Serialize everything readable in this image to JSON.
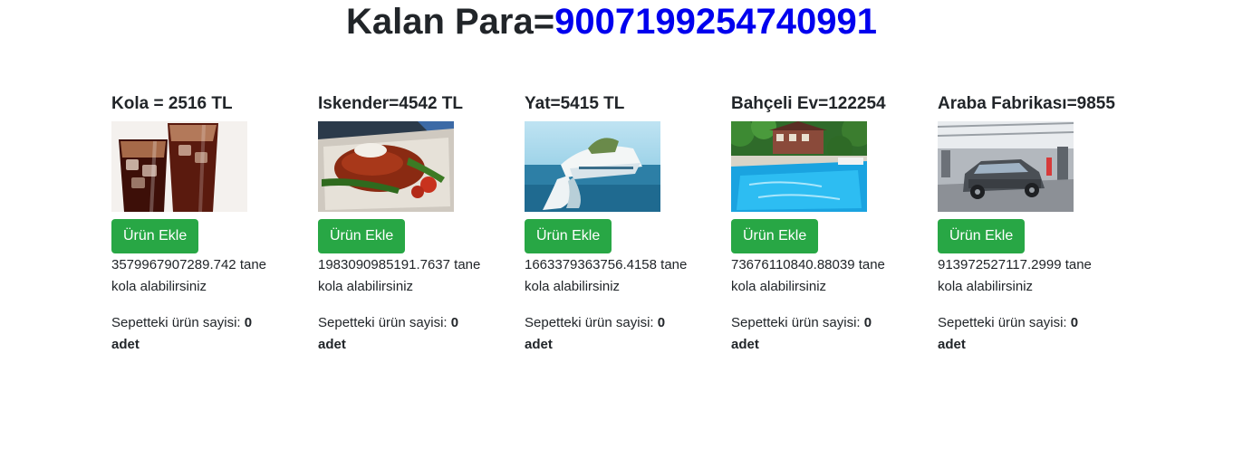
{
  "header": {
    "label": "Kalan Para=",
    "money": "9007199254740991",
    "money_color": "#0000ee"
  },
  "button_color": "#28a745",
  "products": [
    {
      "title": "Kola = 2516 TL",
      "image": "cola-glasses-image",
      "button": "Ürün Ekle",
      "buyable_amount": "3579967907289.742",
      "buyable_suffix": "tane kola alabilirsiniz",
      "count_label": "Sepetteki ürün sayisi:",
      "count_value": "0",
      "count_unit": "adet"
    },
    {
      "title": "Iskender=4542 TL",
      "image": "iskender-plate-image",
      "button": "Ürün Ekle",
      "buyable_amount": "1983090985191.7637",
      "buyable_suffix": "tane kola alabilirsiniz",
      "count_label": "Sepetteki ürün sayisi:",
      "count_value": "0",
      "count_unit": "adet"
    },
    {
      "title": "Yat=5415 TL",
      "image": "yacht-image",
      "button": "Ürün Ekle",
      "buyable_amount": "1663379363756.4158",
      "buyable_suffix": "tane kola alabilirsiniz",
      "count_label": "Sepetteki ürün sayisi:",
      "count_value": "0",
      "count_unit": "adet"
    },
    {
      "title": "Bahçeli Ev=122254",
      "image": "house-with-pool-image",
      "button": "Ürün Ekle",
      "buyable_amount": "73676110840.88039",
      "buyable_suffix": "tane kola alabilirsiniz",
      "count_label": "Sepetteki ürün sayisi:",
      "count_value": "0",
      "count_unit": "adet"
    },
    {
      "title": "Araba Fabrikası=9855",
      "image": "car-factory-image",
      "button": "Ürün Ekle",
      "buyable_amount": "913972527117.2999",
      "buyable_suffix": "tane kola alabilirsiniz",
      "count_label": "Sepetteki ürün sayisi:",
      "count_value": "0",
      "count_unit": "adet"
    }
  ]
}
